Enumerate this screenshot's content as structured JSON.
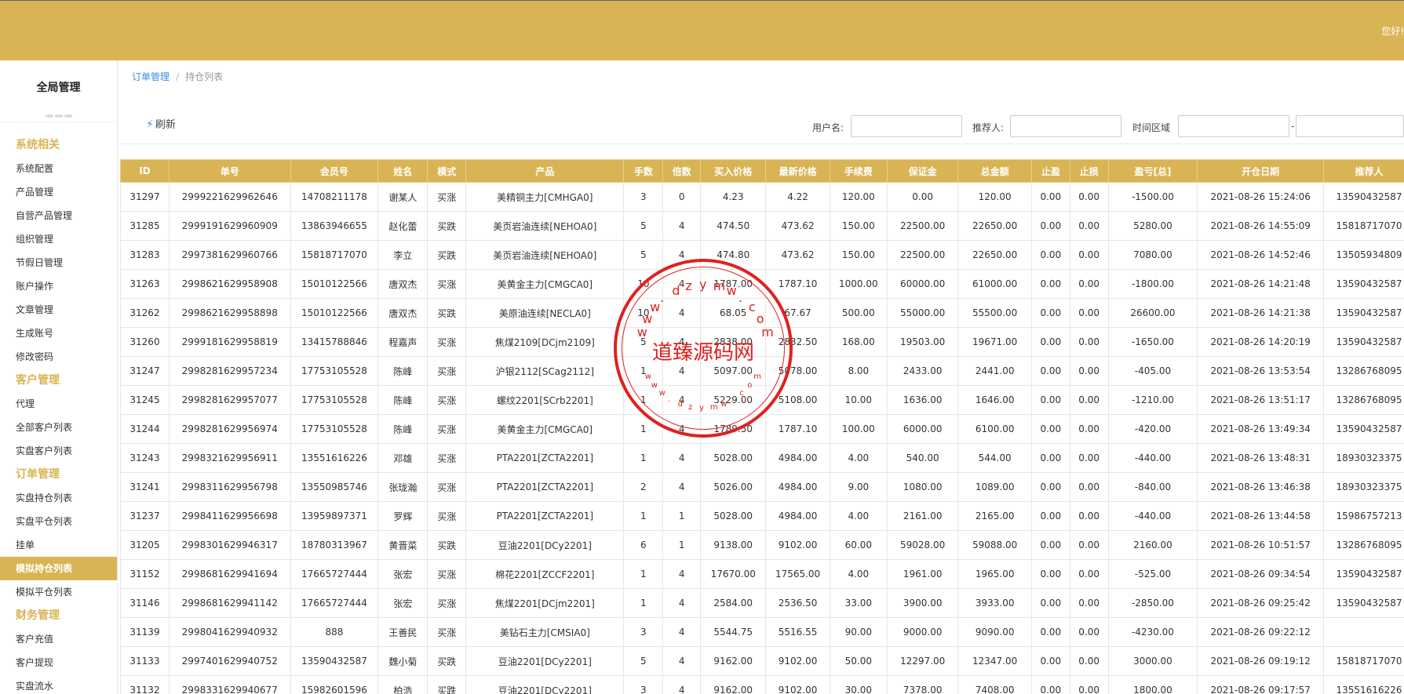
{
  "header": {
    "greeting": "您好!"
  },
  "sidebar": {
    "title": "全局管理",
    "groups": [
      {
        "section": "系统相关",
        "items": [
          "系统配置",
          "产品管理",
          "自营产品管理",
          "组织管理",
          "节假日管理",
          "账户操作",
          "文章管理",
          "生成账号",
          "修改密码"
        ]
      },
      {
        "section": "客户管理",
        "items": [
          "代理",
          "全部客户列表",
          "实盘客户列表"
        ]
      },
      {
        "section": "订单管理",
        "items": [
          "实盘持仓列表",
          "实盘平仓列表",
          "挂单",
          "模拟持仓列表",
          "模拟平仓列表"
        ]
      },
      {
        "section": "财务管理",
        "items": [
          "客户充值",
          "客户提现",
          "实盘流水"
        ]
      }
    ],
    "active_item": "模拟持仓列表"
  },
  "breadcrumb": {
    "parent": "订单管理",
    "current": "持仓列表"
  },
  "toolbar": {
    "refresh_label": "刷新"
  },
  "filters": {
    "username_label": "用户名:",
    "referrer_label": "推荐人:",
    "time_label": "时间区域",
    "dash": "-",
    "username_value": "",
    "referrer_value": "",
    "time_start": "",
    "time_end": ""
  },
  "table": {
    "columns": [
      "ID",
      "单号",
      "会员号",
      "姓名",
      "模式",
      "产品",
      "手数",
      "倍数",
      "买入价格",
      "最新价格",
      "手续费",
      "保证金",
      "总金额",
      "止盈",
      "止损",
      "盈亏[总]",
      "开仓日期",
      "推荐人"
    ],
    "rows": [
      [
        "31297",
        "2999221629962646",
        "14708211178",
        "谢某人",
        "买涨",
        "美精铜主力[CMHGA0]",
        "3",
        "0",
        "4.23",
        "4.22",
        "120.00",
        "0.00",
        "120.00",
        "0.00",
        "0.00",
        "-1500.00",
        "2021-08-26 15:24:06",
        "13590432587"
      ],
      [
        "31285",
        "2999191629960909",
        "13863946655",
        "赵化蕾",
        "买跌",
        "美页岩油连续[NEHOA0]",
        "5",
        "4",
        "474.50",
        "473.62",
        "150.00",
        "22500.00",
        "22650.00",
        "0.00",
        "0.00",
        "5280.00",
        "2021-08-26 14:55:09",
        "15818717070"
      ],
      [
        "31283",
        "2997381629960766",
        "15818717070",
        "李立",
        "买跌",
        "美页岩油连续[NEHOA0]",
        "5",
        "4",
        "474.80",
        "473.62",
        "150.00",
        "22500.00",
        "22650.00",
        "0.00",
        "0.00",
        "7080.00",
        "2021-08-26 14:52:46",
        "13505934809"
      ],
      [
        "31263",
        "2998621629958908",
        "15010122566",
        "唐双杰",
        "买涨",
        "美黄金主力[CMGCA0]",
        "10",
        "4",
        "1787.00",
        "1787.10",
        "1000.00",
        "60000.00",
        "61000.00",
        "0.00",
        "0.00",
        "-1800.00",
        "2021-08-26 14:21:48",
        "13590432587"
      ],
      [
        "31262",
        "2998621629958898",
        "15010122566",
        "唐双杰",
        "买跌",
        "美原油连续[NECLA0]",
        "10",
        "4",
        "68.05",
        "67.67",
        "500.00",
        "55000.00",
        "55500.00",
        "0.00",
        "0.00",
        "26600.00",
        "2021-08-26 14:21:38",
        "13590432587"
      ],
      [
        "31260",
        "2999181629958819",
        "13415788846",
        "程嘉声",
        "买涨",
        "焦煤2109[DCjm2109]",
        "5",
        "4",
        "2838.00",
        "2832.50",
        "168.00",
        "19503.00",
        "19671.00",
        "0.00",
        "0.00",
        "-1650.00",
        "2021-08-26 14:20:19",
        "13590432587"
      ],
      [
        "31247",
        "2998281629957234",
        "17753105528",
        "陈峰",
        "买涨",
        "沪银2112[SCag2112]",
        "1",
        "4",
        "5097.00",
        "5078.00",
        "8.00",
        "2433.00",
        "2441.00",
        "0.00",
        "0.00",
        "-405.00",
        "2021-08-26 13:53:54",
        "13286768095"
      ],
      [
        "31245",
        "2998281629957077",
        "17753105528",
        "陈峰",
        "买涨",
        "螺纹2201[SCrb2201]",
        "1",
        "4",
        "5229.00",
        "5108.00",
        "10.00",
        "1636.00",
        "1646.00",
        "0.00",
        "0.00",
        "-1210.00",
        "2021-08-26 13:51:17",
        "13286768095"
      ],
      [
        "31244",
        "2998281629956974",
        "17753105528",
        "陈峰",
        "买涨",
        "美黄金主力[CMGCA0]",
        "1",
        "4",
        "1789.50",
        "1787.10",
        "100.00",
        "6000.00",
        "6100.00",
        "0.00",
        "0.00",
        "-420.00",
        "2021-08-26 13:49:34",
        "13590432587"
      ],
      [
        "31243",
        "2998321629956911",
        "13551616226",
        "邓雄",
        "买涨",
        "PTA2201[ZCTA2201]",
        "1",
        "4",
        "5028.00",
        "4984.00",
        "4.00",
        "540.00",
        "544.00",
        "0.00",
        "0.00",
        "-440.00",
        "2021-08-26 13:48:31",
        "18930323375"
      ],
      [
        "31241",
        "2998311629956798",
        "13550985746",
        "张珑瀚",
        "买涨",
        "PTA2201[ZCTA2201]",
        "2",
        "4",
        "5026.00",
        "4984.00",
        "9.00",
        "1080.00",
        "1089.00",
        "0.00",
        "0.00",
        "-840.00",
        "2021-08-26 13:46:38",
        "18930323375"
      ],
      [
        "31237",
        "2998411629956698",
        "13959897371",
        "罗辉",
        "买涨",
        "PTA2201[ZCTA2201]",
        "1",
        "1",
        "5028.00",
        "4984.00",
        "4.00",
        "2161.00",
        "2165.00",
        "0.00",
        "0.00",
        "-440.00",
        "2021-08-26 13:44:58",
        "15986757213"
      ],
      [
        "31205",
        "2998301629946317",
        "18780313967",
        "黄晋菜",
        "买跌",
        "豆油2201[DCy2201]",
        "6",
        "1",
        "9138.00",
        "9102.00",
        "60.00",
        "59028.00",
        "59088.00",
        "0.00",
        "0.00",
        "2160.00",
        "2021-08-26 10:51:57",
        "13286768095"
      ],
      [
        "31152",
        "2998681629941694",
        "17665727444",
        "张宏",
        "买涨",
        "棉花2201[ZCCF2201]",
        "1",
        "4",
        "17670.00",
        "17565.00",
        "4.00",
        "1961.00",
        "1965.00",
        "0.00",
        "0.00",
        "-525.00",
        "2021-08-26 09:34:54",
        "13590432587"
      ],
      [
        "31146",
        "2998681629941142",
        "17665727444",
        "张宏",
        "买涨",
        "焦煤2201[DCjm2201]",
        "1",
        "4",
        "2584.00",
        "2536.50",
        "33.00",
        "3900.00",
        "3933.00",
        "0.00",
        "0.00",
        "-2850.00",
        "2021-08-26 09:25:42",
        "13590432587"
      ],
      [
        "31139",
        "2998041629940932",
        "888",
        "王善民",
        "买涨",
        "美钻石主力[CMSIA0]",
        "3",
        "4",
        "5544.75",
        "5516.55",
        "90.00",
        "9000.00",
        "9090.00",
        "0.00",
        "0.00",
        "-4230.00",
        "2021-08-26 09:22:12",
        ""
      ],
      [
        "31133",
        "2997401629940752",
        "13590432587",
        "魏小菊",
        "买跌",
        "豆油2201[DCy2201]",
        "5",
        "4",
        "9162.00",
        "9102.00",
        "50.00",
        "12297.00",
        "12347.00",
        "0.00",
        "0.00",
        "3000.00",
        "2021-08-26 09:19:12",
        "15818717070"
      ],
      [
        "31132",
        "2998331629940677",
        "15982601596",
        "柏浩",
        "买跌",
        "豆油2201[DCy2201]",
        "3",
        "4",
        "9162.00",
        "9102.00",
        "30.00",
        "7378.00",
        "7408.00",
        "0.00",
        "0.00",
        "1800.00",
        "2021-08-26 09:17:57",
        "13551616226"
      ]
    ]
  },
  "stamp": {
    "main_text": "道臻源码网",
    "ring_chars_top": [
      "w",
      "w",
      "w",
      ".",
      "d",
      "z",
      "y",
      "m",
      "w",
      ".",
      "c",
      "o",
      "m"
    ],
    "ring_chars_bottom": [
      "w",
      "w",
      "w",
      ".",
      "d",
      "z",
      "y",
      "m",
      "w",
      ".",
      "c",
      "o",
      "m"
    ]
  }
}
